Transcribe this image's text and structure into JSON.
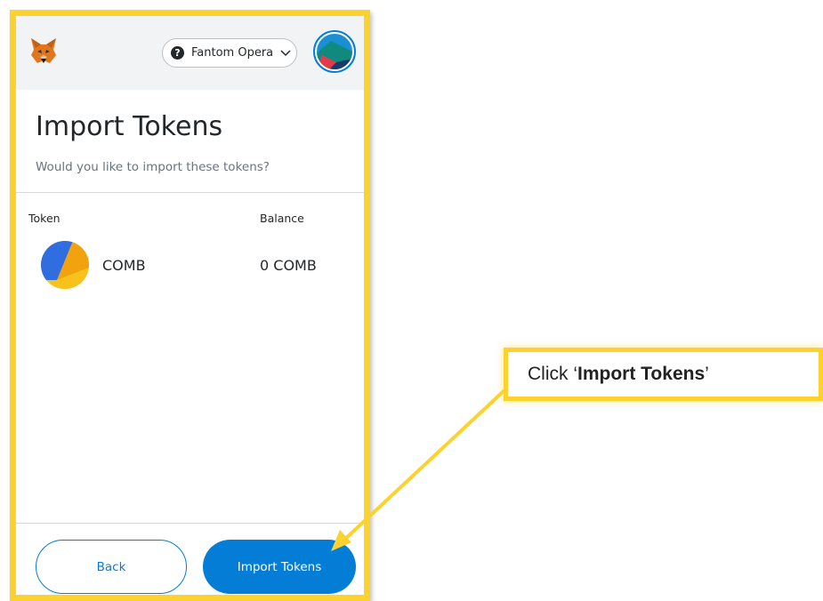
{
  "header": {
    "network_label": "Fantom Opera",
    "network_help_icon": "?"
  },
  "page": {
    "title": "Import Tokens",
    "subtitle": "Would you like to import these tokens?"
  },
  "table": {
    "columns": [
      "Token",
      "Balance"
    ],
    "rows": [
      {
        "token": "COMB",
        "balance": "0 COMB"
      }
    ]
  },
  "footer": {
    "back_label": "Back",
    "import_label": "Import Tokens"
  },
  "callout": {
    "prefix": "Click ‘",
    "bold": "Import Tokens",
    "suffix": "’"
  },
  "colors": {
    "primary": "#037dd6",
    "highlight": "#fcd22e",
    "text": "#24272a",
    "muted": "#6a737d"
  },
  "icons": [
    "metamask-fox-icon",
    "help-icon",
    "chevron-down-icon",
    "account-avatar-icon",
    "comb-token-icon"
  ]
}
